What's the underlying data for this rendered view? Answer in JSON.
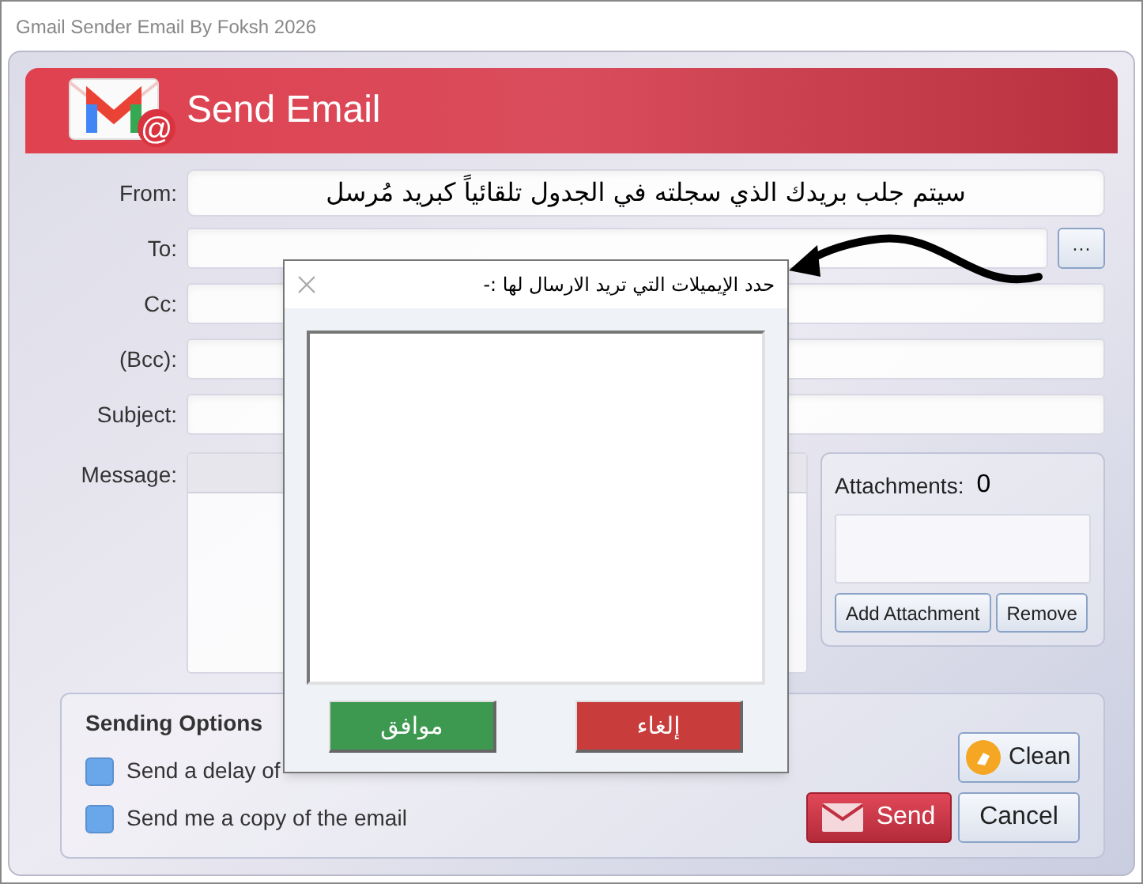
{
  "window": {
    "title": "Gmail Sender Email By Foksh 2026"
  },
  "header": {
    "title": "Send Email",
    "logo_mark": "@"
  },
  "fields": [
    {
      "label": "From:",
      "value": "سيتم جلب بريدك الذي سجلته في الجدول تلقائياً كبريد مُرسل"
    },
    {
      "label": "To:",
      "browse": "···"
    },
    {
      "label": "Cc:"
    },
    {
      "label": "(Bcc):"
    },
    {
      "label": "Subject:"
    }
  ],
  "message": {
    "label": "Message:"
  },
  "attachments": {
    "label": "Attachments:",
    "count": "0",
    "buttons": [
      "Add Attachment",
      "Remove"
    ]
  },
  "sending_options": {
    "title": "Sending Options",
    "options": [
      {
        "label": "Send a delay of",
        "checked": false
      },
      {
        "label": "Send me a copy of the email",
        "checked": false
      }
    ]
  },
  "actions": {
    "clean": "Clean",
    "send": "Send",
    "cancel": "Cancel"
  },
  "dialog": {
    "title": "حدد الإيميلات التي تريد الارسال لها :-",
    "buttons": [
      {
        "label": "إلغاء",
        "kind": "cancel"
      },
      {
        "label": "موافق",
        "kind": "ok"
      }
    ]
  }
}
